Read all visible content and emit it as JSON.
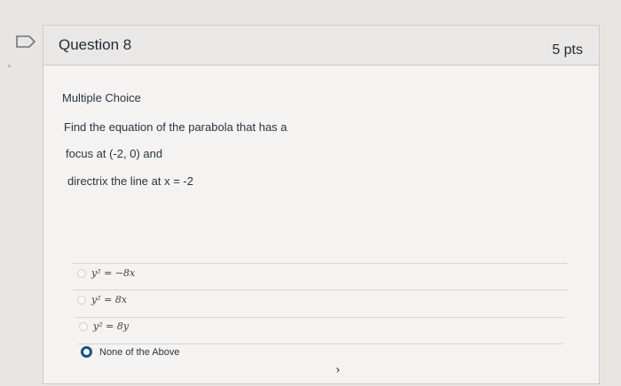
{
  "question": {
    "title": "Question 8",
    "points": "5 pts",
    "type": "Multiple Choice",
    "text_lines": [
      "Find the equation of the parabola that has a",
      "focus at (-2, 0) and",
      "directrix the line at x = -2"
    ]
  },
  "options": [
    {
      "text": "y² = −8x",
      "selected": false
    },
    {
      "text": "y² = 8x",
      "selected": false
    },
    {
      "text": "y² = 8y",
      "selected": false
    },
    {
      "text": "None of the Above",
      "selected": true
    }
  ],
  "colors": {
    "selected_radio": "#1a4f86",
    "card_bg": "#f4f3f1",
    "header_bg": "#e9e8e6"
  },
  "icons": {
    "flag": "bookmark-flag-icon"
  }
}
